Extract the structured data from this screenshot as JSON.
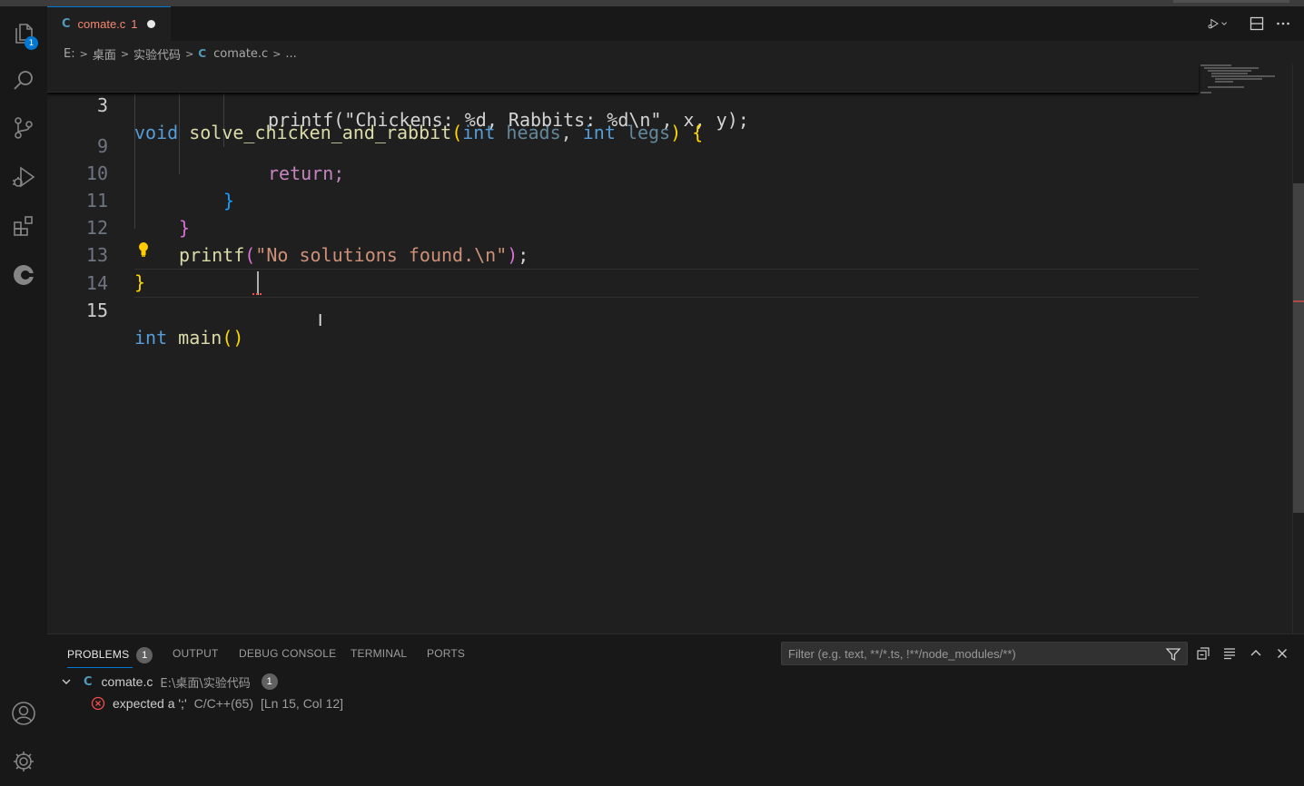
{
  "activity_bar": {
    "explorer_badge": "1"
  },
  "tab": {
    "lang_letter": "C",
    "filename": "comate.c",
    "problem_count": "1"
  },
  "breadcrumb": {
    "drive": "E:",
    "folder1": "桌面",
    "folder2": "实验代码",
    "file_letter": "C",
    "file": "comate.c",
    "more": "..."
  },
  "editor": {
    "sticky": {
      "line_number": "3",
      "text": "void solve_chicken_and_rabbit(int heads, int legs) {"
    },
    "partial_line_text": "printf(\"Chickens: %d, Rabbits: %d\\n\", x, y);",
    "lines": [
      {
        "number": "9",
        "text": "return;"
      },
      {
        "number": "10",
        "text": "}"
      },
      {
        "number": "11",
        "text": "}"
      },
      {
        "number": "12",
        "text": "printf(\"No solutions found.\\n\");"
      },
      {
        "number": "13",
        "text": "}"
      },
      {
        "number": "14",
        "text": ""
      },
      {
        "number": "15",
        "text": "int main()"
      }
    ]
  },
  "panel": {
    "tabs": {
      "problems": "PROBLEMS",
      "problems_count": "1",
      "output": "OUTPUT",
      "debug_console": "DEBUG CONSOLE",
      "terminal": "TERMINAL",
      "ports": "PORTS"
    },
    "filter_placeholder": "Filter (e.g. text, **/*.ts, !**/node_modules/**)",
    "problem_file": {
      "lang_letter": "C",
      "name": "comate.c",
      "path": "E:\\桌面\\实验代码",
      "count": "1"
    },
    "problem": {
      "message": "expected a ';'",
      "source": "C/C++(65)",
      "location": "[Ln 15, Col 12]"
    }
  },
  "colors": {
    "accent": "#0078d4",
    "error": "#f14c4c",
    "modified_tab": "#f48771"
  }
}
